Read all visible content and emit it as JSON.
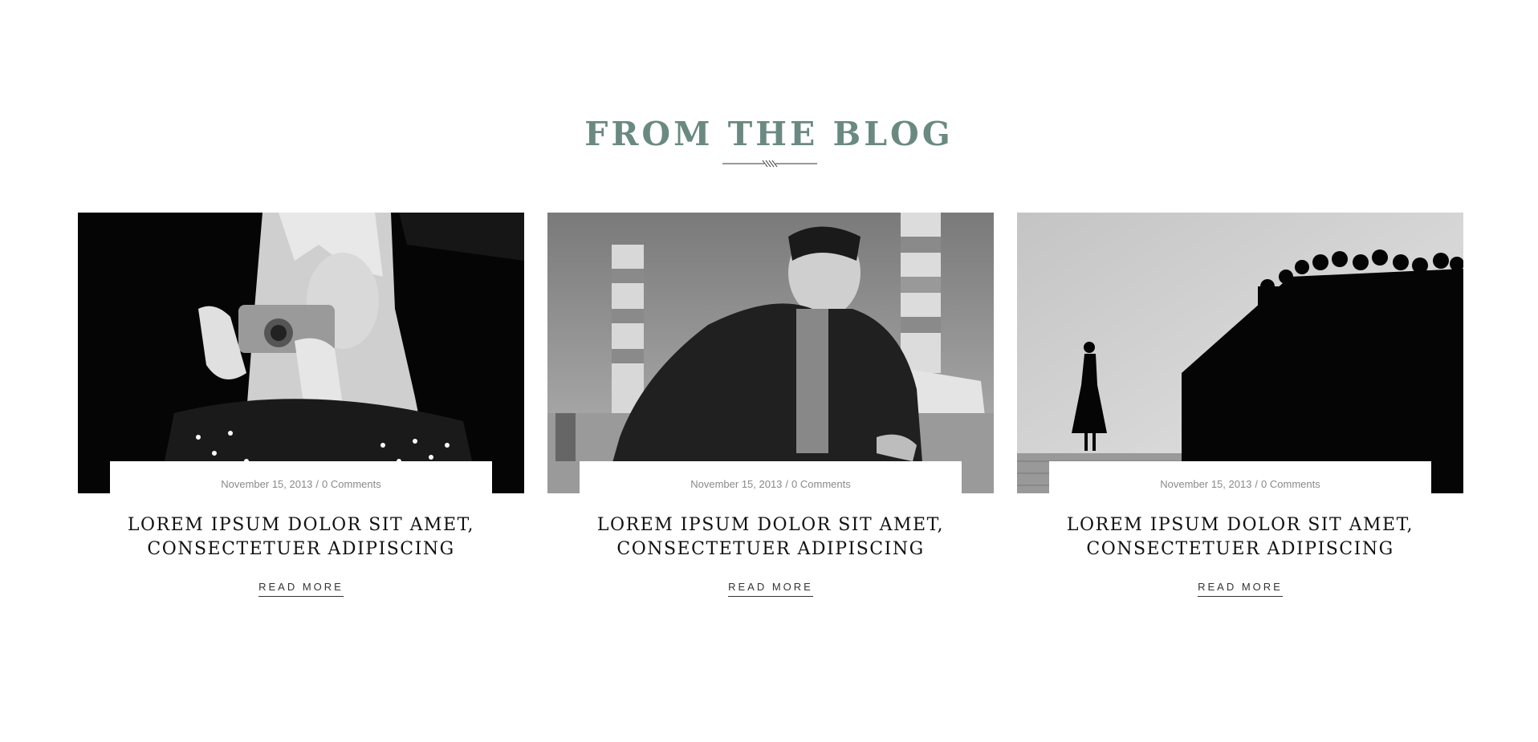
{
  "section": {
    "title": "FROM THE BLOG"
  },
  "posts": [
    {
      "date": "November 15, 2013",
      "separator": "/",
      "comments": "0 Comments",
      "title_line1": "LOREM IPSUM DOLOR SIT AMET,",
      "title_line2": "CONSECTETUER ADIPISCING",
      "read_more": "READ MORE"
    },
    {
      "date": "November 15, 2013",
      "separator": "/",
      "comments": "0 Comments",
      "title_line1": "LOREM IPSUM DOLOR SIT AMET,",
      "title_line2": "CONSECTETUER ADIPISCING",
      "read_more": "READ MORE"
    },
    {
      "date": "November 15, 2013",
      "separator": "/",
      "comments": "0 Comments",
      "title_line1": "LOREM IPSUM DOLOR SIT AMET,",
      "title_line2": "CONSECTETUER ADIPISCING",
      "read_more": "READ MORE"
    }
  ],
  "colors": {
    "title_accent": "#6a8a81",
    "meta_text": "#8a8a8a",
    "post_title": "#111111",
    "link": "#333333"
  }
}
